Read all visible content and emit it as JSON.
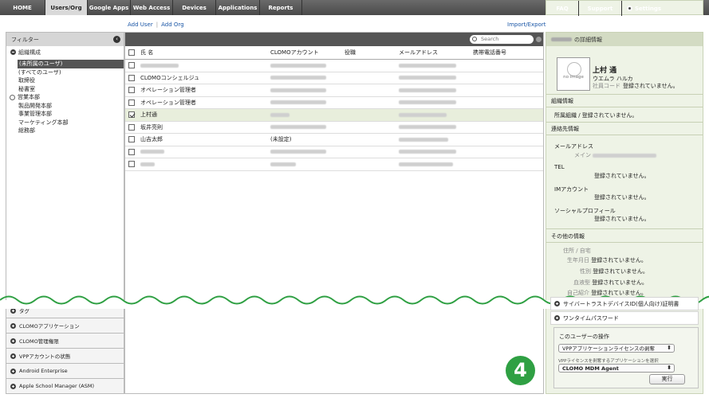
{
  "nav": {
    "tabs": [
      "HOME",
      "Users/Org",
      "Google Apps",
      "Web Access",
      "Devices",
      "Applications",
      "Reports"
    ],
    "active": "Users/Org",
    "right": [
      "FAQ",
      "Support",
      "Settings"
    ]
  },
  "actions": {
    "add_user": "Add User",
    "add_org": "Add Org",
    "import_export": "Import/Export"
  },
  "filter": {
    "title": "フィルター",
    "org_header": "組織構成",
    "tree": [
      "(未所属のユーザ)",
      "(すべてのユーザ)",
      "取締役",
      "秘書室",
      "営業本部",
      "製品開発本部",
      "事業管理本部",
      "マーケティング本部",
      "総務部"
    ],
    "sections": [
      "タグ",
      "CLOMOアプリケーション",
      "CLOMO管理権限",
      "VPPアカウントの状態",
      "Android Enterprise",
      "Apple School Manager (ASM)"
    ]
  },
  "search": {
    "placeholder": "Search"
  },
  "table": {
    "headers": [
      "氏 名",
      "CLOMOアカウント",
      "役職",
      "メールアドレス",
      "携帯電話番号"
    ],
    "rows": [
      {
        "name": "",
        "account": "",
        "email": ""
      },
      {
        "name": "CLOMOコンシェルジュ",
        "account": "",
        "email": ""
      },
      {
        "name": "オペレーション管理者",
        "account": "",
        "email": ""
      },
      {
        "name": "オペレーション管理者",
        "account": "",
        "email": ""
      },
      {
        "name": "上村通",
        "account": "",
        "email": ""
      },
      {
        "name": "坂井亮則",
        "account": "",
        "email": ""
      },
      {
        "name": "山吉太郎",
        "account": "(未設定)",
        "email": ""
      },
      {
        "name": "",
        "account": "",
        "email": ""
      },
      {
        "name": "",
        "account": "",
        "email": ""
      }
    ]
  },
  "detail": {
    "title_suffix": "の詳細情報",
    "no_image": "no image",
    "name": "上村 通",
    "kana": "ウエムラ ハルカ",
    "emp_label": "社員コード",
    "emp_value": "登録されていません。",
    "org_info": "組織情報",
    "org_value": "所属組織 / 登録されていません。",
    "contact": "連絡先情報",
    "mail": "メールアドレス",
    "mail_main": "メイン",
    "tel": "TEL",
    "tel_val": "登録されていません。",
    "im": "IMアカウント",
    "im_val": "登録されていません。",
    "social": "ソーシャルプロフィール",
    "social_val": "登録されていません。",
    "other": "その他の情報",
    "address": "住所 / 自宅",
    "birthday_label": "生年月日",
    "birthday_val": "登録されていません。",
    "gender_label": "性別",
    "gender_val": "登録されていません。",
    "blood_label": "血液型",
    "blood_val": "登録されていません。",
    "intro_label": "自己紹介",
    "intro_val": "登録されていません。",
    "cyber": "サイバートラストデバイスID(個人向け)証明書",
    "otp": "ワンタイムパスワード",
    "ops_title": "このユーザーの操作",
    "op_select": "VPPアプリケーションライセンスの剥奪",
    "op_note": "VPPライセンスを剥奪するアプリケーションを選択",
    "app_select": "CLOMO MDM Agent",
    "exec": "実行",
    "step": "4"
  }
}
